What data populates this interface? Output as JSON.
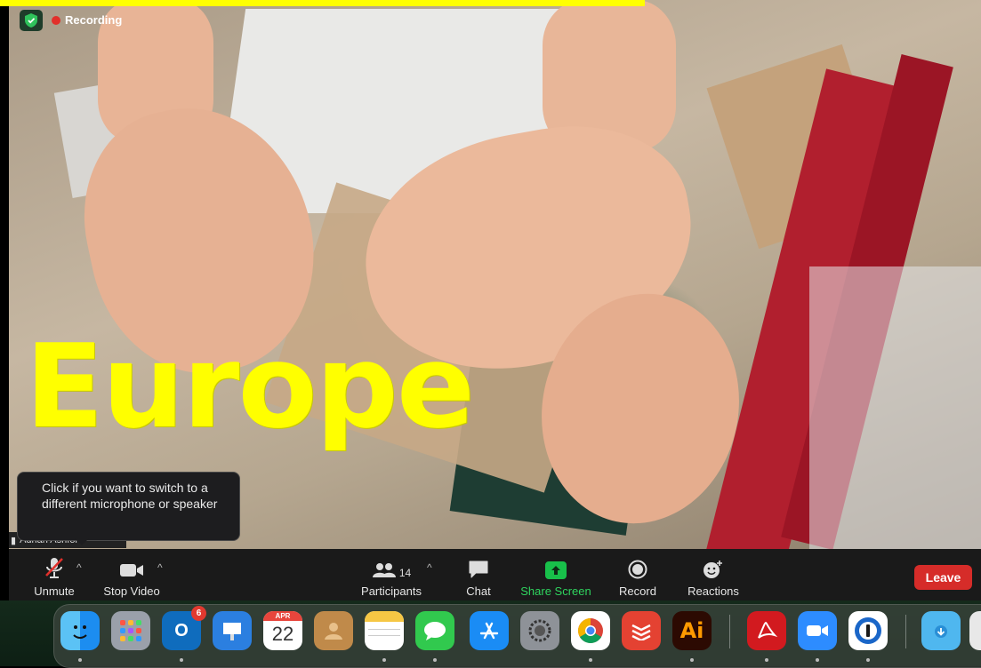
{
  "overlay": {
    "title": "Europe"
  },
  "meeting": {
    "recording_label": "Recording",
    "participant_name": "Adrian Ashford",
    "tooltip": {
      "line1": "Click if you want to switch to a",
      "line2": "different microphone or speaker"
    }
  },
  "toolbar": {
    "unmute_label": "Unmute",
    "stop_video_label": "Stop Video",
    "participants_label": "Participants",
    "participants_count": "14",
    "chat_label": "Chat",
    "share_screen_label": "Share Screen",
    "record_label": "Record",
    "reactions_label": "Reactions",
    "leave_label": "Leave"
  },
  "dock": {
    "outlook_badge": "6",
    "calendar_month": "APR",
    "calendar_day": "22"
  },
  "colors": {
    "title_yellow": "#ffff00",
    "leave_red": "#d62c29",
    "share_green": "#18c04a",
    "toolbar_bg": "#1a1a1a"
  }
}
